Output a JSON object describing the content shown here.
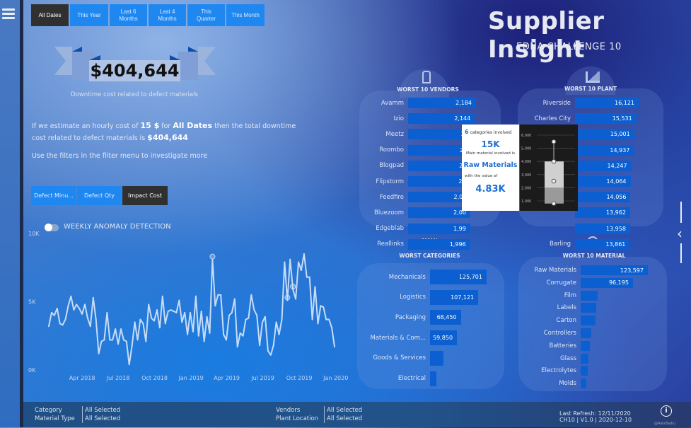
{
  "header": {
    "title": "Supplier Insight",
    "subtitle": "EDNA CHALLENGE 10"
  },
  "date_filters": [
    {
      "label": "All Dates",
      "active": true
    },
    {
      "label": "This Year"
    },
    {
      "label": "Last 6 Months"
    },
    {
      "label": "Last 4 Months"
    },
    {
      "label": "This Quarter"
    },
    {
      "label": "This Month"
    }
  ],
  "kpi": {
    "amount": "$404,644",
    "caption": "Downtime cost related to defect materials"
  },
  "narrative": {
    "p1_a": "If we estimate an hourly cost of ",
    "p1_rate": "15 $",
    "p1_b": " for ",
    "p1_period": "All Dates",
    "p1_c": " then the total downtime cost related to defect materials is ",
    "p1_total": "$404,644",
    "p2": "Use the filters in the filter menu to investigate more"
  },
  "measure_buttons": [
    {
      "label": "Defect Minu..."
    },
    {
      "label": "Defect Qty"
    },
    {
      "label": "Impact Cost",
      "active": true
    }
  ],
  "colors": {
    "accent": "#1e88f0",
    "bar": "#0b5fd0",
    "active_button": "#303030",
    "line": "#c6dcf7"
  },
  "chart_data": [
    {
      "type": "line",
      "title": "WEEKLY ANOMALY DETECTION",
      "ylim": [
        0,
        10000
      ],
      "yticks": [
        "0K",
        "5K",
        "10K"
      ],
      "xticks": [
        "Apr 2018",
        "Jul 2018",
        "Oct 2018",
        "Jan 2019",
        "Apr 2019",
        "Jul 2019",
        "Oct 2019",
        "Jan 2020"
      ],
      "xtick_dates": [
        "2018-04-01",
        "2018-07-01",
        "2018-10-01",
        "2019-01-01",
        "2019-04-01",
        "2019-07-01",
        "2019-10-01",
        "2020-01-01"
      ],
      "grid": false,
      "x": [
        "2018-01-07",
        "2018-01-14",
        "2018-01-21",
        "2018-01-28",
        "2018-02-04",
        "2018-02-11",
        "2018-02-18",
        "2018-02-25",
        "2018-03-04",
        "2018-03-11",
        "2018-03-18",
        "2018-03-25",
        "2018-04-01",
        "2018-04-08",
        "2018-04-15",
        "2018-04-22",
        "2018-04-29",
        "2018-05-06",
        "2018-05-13",
        "2018-05-20",
        "2018-05-27",
        "2018-06-03",
        "2018-06-10",
        "2018-06-17",
        "2018-06-24",
        "2018-07-01",
        "2018-07-08",
        "2018-07-15",
        "2018-07-22",
        "2018-07-29",
        "2018-08-05",
        "2018-08-12",
        "2018-08-19",
        "2018-08-26",
        "2018-09-02",
        "2018-09-09",
        "2018-09-16",
        "2018-09-23",
        "2018-09-30",
        "2018-10-07",
        "2018-10-14",
        "2018-10-21",
        "2018-10-28",
        "2018-11-04",
        "2018-11-11",
        "2018-11-18",
        "2018-11-25",
        "2018-12-02",
        "2018-12-09",
        "2018-12-16",
        "2018-12-23",
        "2018-12-30",
        "2019-01-06",
        "2019-01-13",
        "2019-01-20",
        "2019-01-27",
        "2019-02-03",
        "2019-02-10",
        "2019-02-17",
        "2019-02-24",
        "2019-03-03",
        "2019-03-10",
        "2019-03-17",
        "2019-03-24",
        "2019-03-31",
        "2019-04-07",
        "2019-04-14",
        "2019-04-21",
        "2019-04-28",
        "2019-05-05",
        "2019-05-12",
        "2019-05-19",
        "2019-05-26",
        "2019-06-02",
        "2019-06-09",
        "2019-06-16",
        "2019-06-23",
        "2019-06-30",
        "2019-07-07",
        "2019-07-14",
        "2019-07-21",
        "2019-07-28",
        "2019-08-04",
        "2019-08-11",
        "2019-08-18",
        "2019-08-25",
        "2019-09-01",
        "2019-09-08",
        "2019-09-15",
        "2019-09-22",
        "2019-09-29",
        "2019-10-06",
        "2019-10-13",
        "2019-10-20",
        "2019-10-27",
        "2019-11-03",
        "2019-11-10",
        "2019-11-17",
        "2019-11-24",
        "2019-12-01",
        "2019-12-08",
        "2019-12-15",
        "2019-12-22",
        "2019-12-29"
      ],
      "values": [
        3200,
        4200,
        4000,
        4500,
        3400,
        3300,
        3700,
        4700,
        5400,
        4400,
        4800,
        4500,
        4100,
        4800,
        3800,
        3200,
        5300,
        3700,
        1200,
        2100,
        2200,
        4200,
        2200,
        2200,
        3000,
        1900,
        3000,
        2200,
        2100,
        400,
        1800,
        3500,
        2200,
        3700,
        3400,
        2100,
        4800,
        3800,
        3600,
        4400,
        3100,
        5400,
        3400,
        4300,
        4400,
        4300,
        4200,
        5100,
        3500,
        4200,
        2600,
        4200,
        2800,
        5400,
        2500,
        4300,
        2100,
        3900,
        2700,
        8100,
        4700,
        5500,
        5500,
        2600,
        2200,
        4000,
        4200,
        5200,
        1700,
        2700,
        2500,
        3700,
        3800,
        5500,
        4400,
        4000,
        1800,
        3500,
        3900,
        1400,
        1100,
        1800,
        3500,
        2600,
        3700,
        7900,
        5100,
        8100,
        5900,
        5200,
        7900,
        7300,
        8500,
        6800,
        6800,
        3700,
        6100,
        3400,
        4700,
        4600,
        3700,
        3700,
        3100,
        1700
      ],
      "anomalies": [
        "2019-02-24",
        "2019-09-01",
        "2019-09-15"
      ]
    },
    {
      "type": "bar",
      "orientation": "horizontal",
      "title": "WORST 10 VENDORS",
      "categories": [
        "Avamm",
        "Izio",
        "Meetz",
        "Roombo",
        "Blogpad",
        "Flipstorm",
        "Feedfire",
        "Bluezoom",
        "Edgeblab",
        "Reallinks"
      ],
      "values": [
        2184,
        2144,
        2130,
        2090,
        2070,
        2050,
        2010,
        2000,
        1998,
        1996
      ],
      "labels": [
        "2,184",
        "2,144",
        "2,1",
        "2,0",
        "2,0",
        "2,0",
        "2,01",
        "2,00",
        "1,99",
        "1,996"
      ]
    },
    {
      "type": "bar",
      "orientation": "horizontal",
      "title": "WORST 10 PLANT",
      "categories": [
        "Riverside",
        "Charles City",
        "",
        "",
        "",
        "",
        "",
        "",
        "",
        "Barling"
      ],
      "values": [
        16121,
        15531,
        15001,
        14937,
        14247,
        14064,
        14056,
        13962,
        13958,
        13861
      ],
      "labels": [
        "16,121",
        "15,531",
        "15,001",
        "14,937",
        "14,247",
        "14,064",
        "14,056",
        "13,962",
        "13,958",
        "13,861"
      ]
    },
    {
      "type": "bar",
      "orientation": "horizontal",
      "title": "WORST CATEGORIES",
      "categories": [
        "Mechanicals",
        "Logistics",
        "Packaging",
        "Materials & Com...",
        "Goods & Services",
        "Electrical"
      ],
      "values": [
        125701,
        107121,
        68450,
        59850,
        29900,
        14100
      ],
      "labels": [
        "125,701",
        "107,121",
        "68,450",
        "59,850",
        "",
        ""
      ]
    },
    {
      "type": "bar",
      "orientation": "horizontal",
      "title": "WORST 10 MATERIAL",
      "categories": [
        "Raw Materials",
        "Corrugate",
        "Film",
        "Labels",
        "Carton",
        "Controllers",
        "Batteries",
        "Glass",
        "Electrolytes",
        "Molds"
      ],
      "values": [
        123597,
        96195,
        31000,
        28600,
        27300,
        19500,
        17000,
        14300,
        13000,
        10400
      ],
      "labels": [
        "123,597",
        "96,195",
        "",
        "",
        "",
        "",
        "",
        "",
        "",
        ""
      ]
    },
    {
      "type": "box",
      "yticks": [
        "1,000",
        "2,000",
        "3,000",
        "4,000",
        "5,000",
        "6,000"
      ],
      "ylim": [
        500,
        6300
      ],
      "min": 800,
      "q1": 800,
      "median": 2000,
      "mean": 2500,
      "q3": 4000,
      "max": 5500
    }
  ],
  "tooltip": {
    "count": "6",
    "count_text": "categories involved",
    "total": "15K",
    "main_text": "Main material involved is",
    "material": "Raw Materials",
    "value_text": "with the value of",
    "value": "4.83K"
  },
  "footer": {
    "filters_left": [
      {
        "label": "Category",
        "value": "All Selected"
      },
      {
        "label": "Material Type",
        "value": "All Selected"
      }
    ],
    "filters_right": [
      {
        "label": "Vendors",
        "value": "All Selected"
      },
      {
        "label": "Plant Location",
        "value": "All Selected"
      }
    ],
    "refresh": "Last Refresh: 12/11/2020",
    "version": "CH10 | V1.0 | 2020-12-10",
    "credit": "@AlexBadiu"
  }
}
